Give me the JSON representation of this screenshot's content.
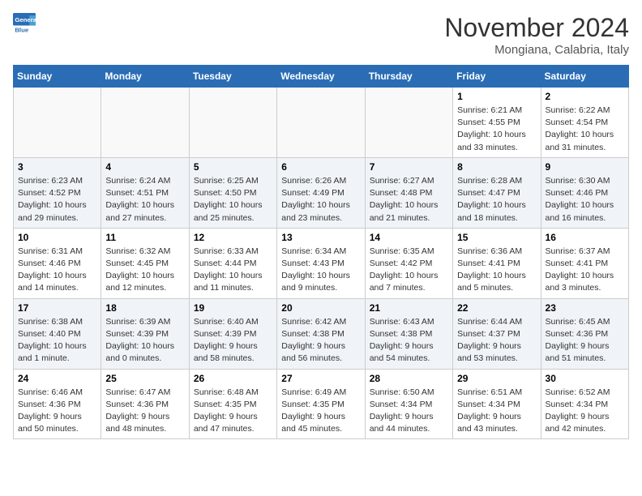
{
  "header": {
    "logo_line1": "General",
    "logo_line2": "Blue",
    "month": "November 2024",
    "location": "Mongiana, Calabria, Italy"
  },
  "days_of_week": [
    "Sunday",
    "Monday",
    "Tuesday",
    "Wednesday",
    "Thursday",
    "Friday",
    "Saturday"
  ],
  "weeks": [
    [
      {
        "day": "",
        "empty": true
      },
      {
        "day": "",
        "empty": true
      },
      {
        "day": "",
        "empty": true
      },
      {
        "day": "",
        "empty": true
      },
      {
        "day": "",
        "empty": true
      },
      {
        "day": "1",
        "sunrise": "Sunrise: 6:21 AM",
        "sunset": "Sunset: 4:55 PM",
        "daylight": "Daylight: 10 hours and 33 minutes."
      },
      {
        "day": "2",
        "sunrise": "Sunrise: 6:22 AM",
        "sunset": "Sunset: 4:54 PM",
        "daylight": "Daylight: 10 hours and 31 minutes."
      }
    ],
    [
      {
        "day": "3",
        "sunrise": "Sunrise: 6:23 AM",
        "sunset": "Sunset: 4:52 PM",
        "daylight": "Daylight: 10 hours and 29 minutes."
      },
      {
        "day": "4",
        "sunrise": "Sunrise: 6:24 AM",
        "sunset": "Sunset: 4:51 PM",
        "daylight": "Daylight: 10 hours and 27 minutes."
      },
      {
        "day": "5",
        "sunrise": "Sunrise: 6:25 AM",
        "sunset": "Sunset: 4:50 PM",
        "daylight": "Daylight: 10 hours and 25 minutes."
      },
      {
        "day": "6",
        "sunrise": "Sunrise: 6:26 AM",
        "sunset": "Sunset: 4:49 PM",
        "daylight": "Daylight: 10 hours and 23 minutes."
      },
      {
        "day": "7",
        "sunrise": "Sunrise: 6:27 AM",
        "sunset": "Sunset: 4:48 PM",
        "daylight": "Daylight: 10 hours and 21 minutes."
      },
      {
        "day": "8",
        "sunrise": "Sunrise: 6:28 AM",
        "sunset": "Sunset: 4:47 PM",
        "daylight": "Daylight: 10 hours and 18 minutes."
      },
      {
        "day": "9",
        "sunrise": "Sunrise: 6:30 AM",
        "sunset": "Sunset: 4:46 PM",
        "daylight": "Daylight: 10 hours and 16 minutes."
      }
    ],
    [
      {
        "day": "10",
        "sunrise": "Sunrise: 6:31 AM",
        "sunset": "Sunset: 4:46 PM",
        "daylight": "Daylight: 10 hours and 14 minutes."
      },
      {
        "day": "11",
        "sunrise": "Sunrise: 6:32 AM",
        "sunset": "Sunset: 4:45 PM",
        "daylight": "Daylight: 10 hours and 12 minutes."
      },
      {
        "day": "12",
        "sunrise": "Sunrise: 6:33 AM",
        "sunset": "Sunset: 4:44 PM",
        "daylight": "Daylight: 10 hours and 11 minutes."
      },
      {
        "day": "13",
        "sunrise": "Sunrise: 6:34 AM",
        "sunset": "Sunset: 4:43 PM",
        "daylight": "Daylight: 10 hours and 9 minutes."
      },
      {
        "day": "14",
        "sunrise": "Sunrise: 6:35 AM",
        "sunset": "Sunset: 4:42 PM",
        "daylight": "Daylight: 10 hours and 7 minutes."
      },
      {
        "day": "15",
        "sunrise": "Sunrise: 6:36 AM",
        "sunset": "Sunset: 4:41 PM",
        "daylight": "Daylight: 10 hours and 5 minutes."
      },
      {
        "day": "16",
        "sunrise": "Sunrise: 6:37 AM",
        "sunset": "Sunset: 4:41 PM",
        "daylight": "Daylight: 10 hours and 3 minutes."
      }
    ],
    [
      {
        "day": "17",
        "sunrise": "Sunrise: 6:38 AM",
        "sunset": "Sunset: 4:40 PM",
        "daylight": "Daylight: 10 hours and 1 minute."
      },
      {
        "day": "18",
        "sunrise": "Sunrise: 6:39 AM",
        "sunset": "Sunset: 4:39 PM",
        "daylight": "Daylight: 10 hours and 0 minutes."
      },
      {
        "day": "19",
        "sunrise": "Sunrise: 6:40 AM",
        "sunset": "Sunset: 4:39 PM",
        "daylight": "Daylight: 9 hours and 58 minutes."
      },
      {
        "day": "20",
        "sunrise": "Sunrise: 6:42 AM",
        "sunset": "Sunset: 4:38 PM",
        "daylight": "Daylight: 9 hours and 56 minutes."
      },
      {
        "day": "21",
        "sunrise": "Sunrise: 6:43 AM",
        "sunset": "Sunset: 4:38 PM",
        "daylight": "Daylight: 9 hours and 54 minutes."
      },
      {
        "day": "22",
        "sunrise": "Sunrise: 6:44 AM",
        "sunset": "Sunset: 4:37 PM",
        "daylight": "Daylight: 9 hours and 53 minutes."
      },
      {
        "day": "23",
        "sunrise": "Sunrise: 6:45 AM",
        "sunset": "Sunset: 4:36 PM",
        "daylight": "Daylight: 9 hours and 51 minutes."
      }
    ],
    [
      {
        "day": "24",
        "sunrise": "Sunrise: 6:46 AM",
        "sunset": "Sunset: 4:36 PM",
        "daylight": "Daylight: 9 hours and 50 minutes."
      },
      {
        "day": "25",
        "sunrise": "Sunrise: 6:47 AM",
        "sunset": "Sunset: 4:36 PM",
        "daylight": "Daylight: 9 hours and 48 minutes."
      },
      {
        "day": "26",
        "sunrise": "Sunrise: 6:48 AM",
        "sunset": "Sunset: 4:35 PM",
        "daylight": "Daylight: 9 hours and 47 minutes."
      },
      {
        "day": "27",
        "sunrise": "Sunrise: 6:49 AM",
        "sunset": "Sunset: 4:35 PM",
        "daylight": "Daylight: 9 hours and 45 minutes."
      },
      {
        "day": "28",
        "sunrise": "Sunrise: 6:50 AM",
        "sunset": "Sunset: 4:34 PM",
        "daylight": "Daylight: 9 hours and 44 minutes."
      },
      {
        "day": "29",
        "sunrise": "Sunrise: 6:51 AM",
        "sunset": "Sunset: 4:34 PM",
        "daylight": "Daylight: 9 hours and 43 minutes."
      },
      {
        "day": "30",
        "sunrise": "Sunrise: 6:52 AM",
        "sunset": "Sunset: 4:34 PM",
        "daylight": "Daylight: 9 hours and 42 minutes."
      }
    ]
  ]
}
